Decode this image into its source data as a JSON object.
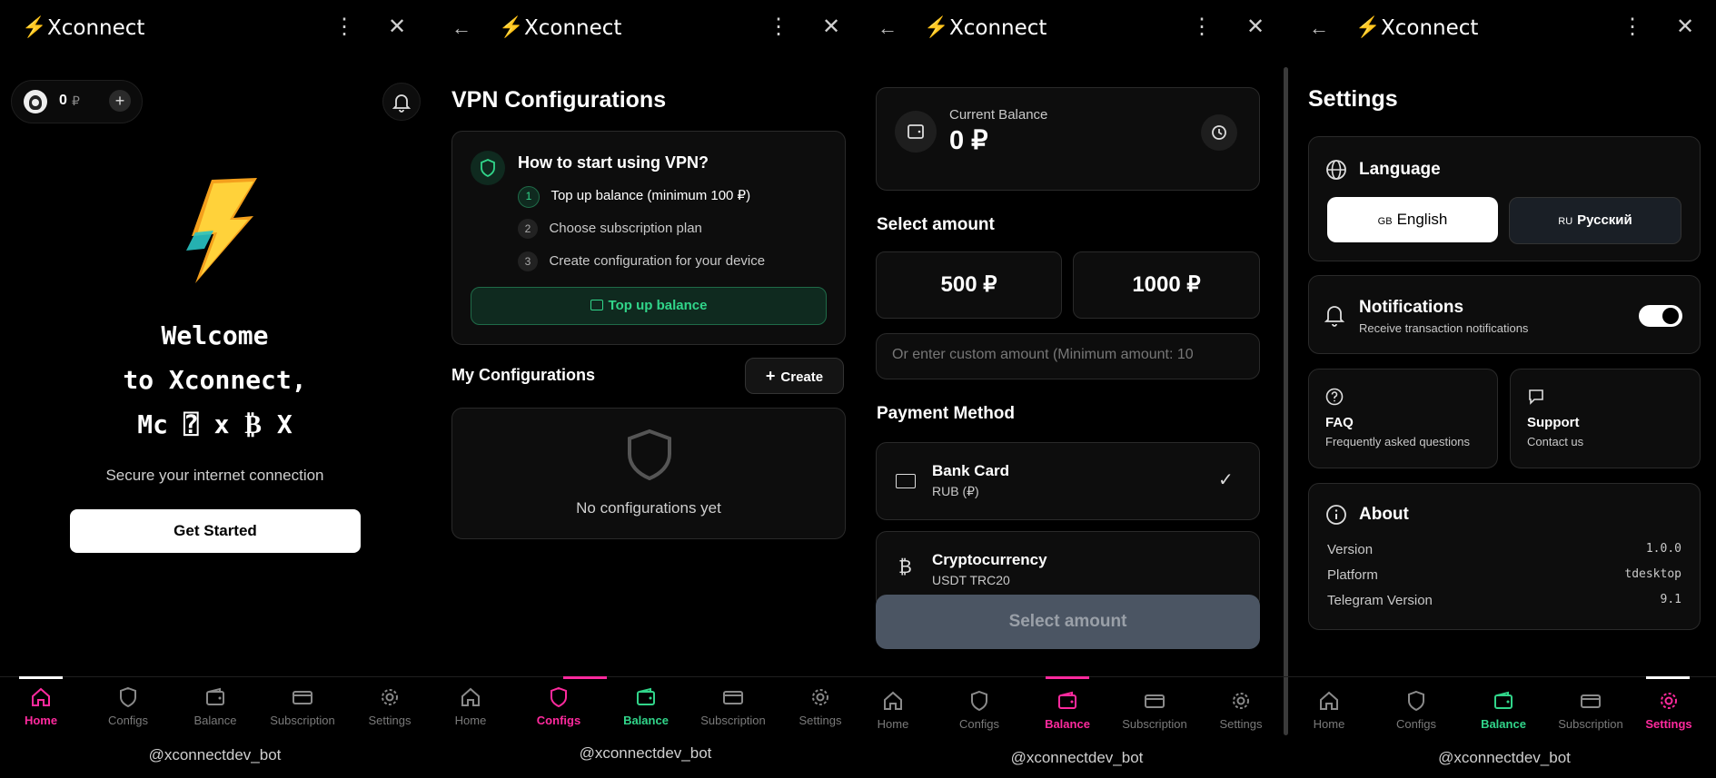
{
  "app": {
    "title": "Xconnect",
    "bolt": "⚡",
    "back": "←",
    "menu": "⋮",
    "close": "✕"
  },
  "nav": [
    "Home",
    "Configs",
    "Balance",
    "Subscription",
    "Settings"
  ],
  "bot_handle": "@xconnectdev_bot",
  "home": {
    "balance": "0",
    "currency": "₽",
    "add": "+",
    "welcome_line1": "Welcome",
    "welcome_line2": "to Xconnect,",
    "welcome_line3": "Mc ⍰ x ₿ X",
    "subtitle": "Secure your internet connection",
    "cta": "Get Started"
  },
  "configs": {
    "title": "VPN Configurations",
    "howto_title": "How to start using VPN?",
    "steps": [
      {
        "n": "1",
        "text": "Top up balance (minimum 100 ₽)"
      },
      {
        "n": "2",
        "text": "Choose subscription plan"
      },
      {
        "n": "3",
        "text": "Create configuration for your device"
      }
    ],
    "topup": "Top up balance",
    "my_configs": "My Configurations",
    "create": "Create",
    "empty": "No configurations yet"
  },
  "balance": {
    "current_label": "Current Balance",
    "current_value": "0 ₽",
    "select_amount": "Select amount",
    "amounts": [
      "500 ₽",
      "1000 ₽"
    ],
    "custom_placeholder": "Or enter custom amount (Minimum amount: 10",
    "payment_method": "Payment Method",
    "methods": [
      {
        "name": "Bank Card",
        "sub": "RUB (₽)",
        "check": "✓"
      },
      {
        "name": "Cryptocurrency",
        "sub": "USDT TRC20",
        "icon": "₿"
      }
    ],
    "submit": "Select amount"
  },
  "settings": {
    "title": "Settings",
    "language": "Language",
    "lang_en_code": "GB",
    "lang_en": "English",
    "lang_ru_code": "RU",
    "lang_ru": "Русский",
    "notifications": "Notifications",
    "notifications_sub": "Receive transaction notifications",
    "faq": "FAQ",
    "faq_sub": "Frequently asked questions",
    "support": "Support",
    "support_sub": "Contact us",
    "about": "About",
    "about_rows": [
      {
        "k": "Version",
        "v": "1.0.0"
      },
      {
        "k": "Platform",
        "v": "tdesktop"
      },
      {
        "k": "Telegram Version",
        "v": "9.1"
      }
    ]
  },
  "colors": {
    "pink": "#ff2a9e",
    "green": "#31d58a",
    "bg": "#000000",
    "card": "#0d0d0d"
  }
}
